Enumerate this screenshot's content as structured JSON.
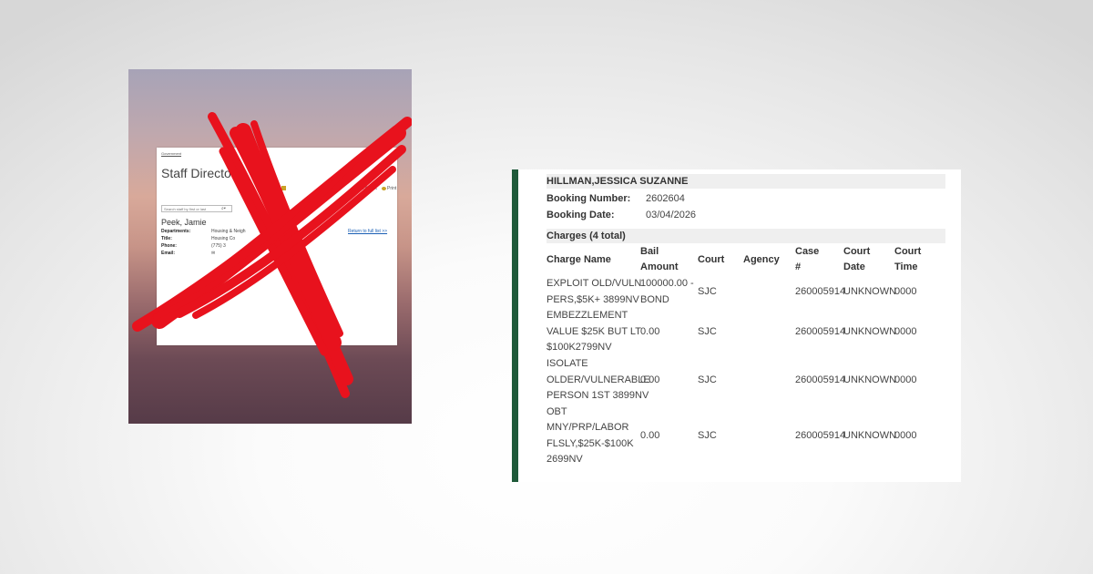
{
  "left_screenshot": {
    "breadcrumb": "Government",
    "title": "Staff Directo",
    "toolbar": {
      "item1": "ns",
      "feedback": "Feedback",
      "print": "Print"
    },
    "search": {
      "placeholder": "Search staff by first or last"
    },
    "person": {
      "name": "Peek, Jamie",
      "fields": [
        {
          "label": "Departments:",
          "value": "Housing & Neigh"
        },
        {
          "label": "Title:",
          "value": "Housing Co"
        },
        {
          "label": "Phone:",
          "value": "(775) 3"
        },
        {
          "label": "Email:",
          "value": ""
        }
      ]
    },
    "return_link": "Return to full list >>",
    "overlay_color": "#e8121d"
  },
  "booking": {
    "name": "HILLMAN,JESSICA SUZANNE",
    "booking_number_label": "Booking Number:",
    "booking_number": "2602604",
    "booking_date_label": "Booking Date:",
    "booking_date": "03/04/2026",
    "charges_title": "Charges (4 total)",
    "columns": {
      "charge_name": "Charge Name",
      "bail": [
        "Bail",
        "Amount"
      ],
      "court": "Court",
      "agency": "Agency",
      "case": [
        "Case",
        "#"
      ],
      "court_date": [
        "Court",
        "Date"
      ],
      "court_time": [
        "Court",
        "Time"
      ]
    },
    "charges": [
      {
        "name_lines": [
          "EXPLOIT OLD/VULN",
          "PERS,$5K+ 3899NV"
        ],
        "bail_lines": [
          "100000.00 -",
          "BOND"
        ],
        "court": "SJC",
        "agency": "",
        "case": "260005914",
        "court_date": "UNKNOWN",
        "court_time": "0000"
      },
      {
        "name_lines": [
          "EMBEZZLEMENT",
          "VALUE $25K BUT LT",
          "$100K2799NV"
        ],
        "bail_lines": [
          "0.00"
        ],
        "court": "SJC",
        "agency": "",
        "case": "260005914",
        "court_date": "UNKNOWN",
        "court_time": "0000"
      },
      {
        "name_lines": [
          "ISOLATE",
          "OLDER/VULNERABLE",
          "PERSON 1ST 3899NV",
          "OBT"
        ],
        "bail_lines": [
          "0.00"
        ],
        "court": "SJC",
        "agency": "",
        "case": "260005914",
        "court_date": "UNKNOWN",
        "court_time": "0000"
      },
      {
        "name_lines": [
          "MNY/PRP/LABOR",
          "FLSLY,$25K-$100K",
          "2699NV"
        ],
        "bail_lines": [
          "0.00"
        ],
        "court": "SJC",
        "agency": "",
        "case": "260005914",
        "court_date": "UNKNOWN",
        "court_time": "0000"
      }
    ],
    "accent_color": "#1f5a3a"
  }
}
